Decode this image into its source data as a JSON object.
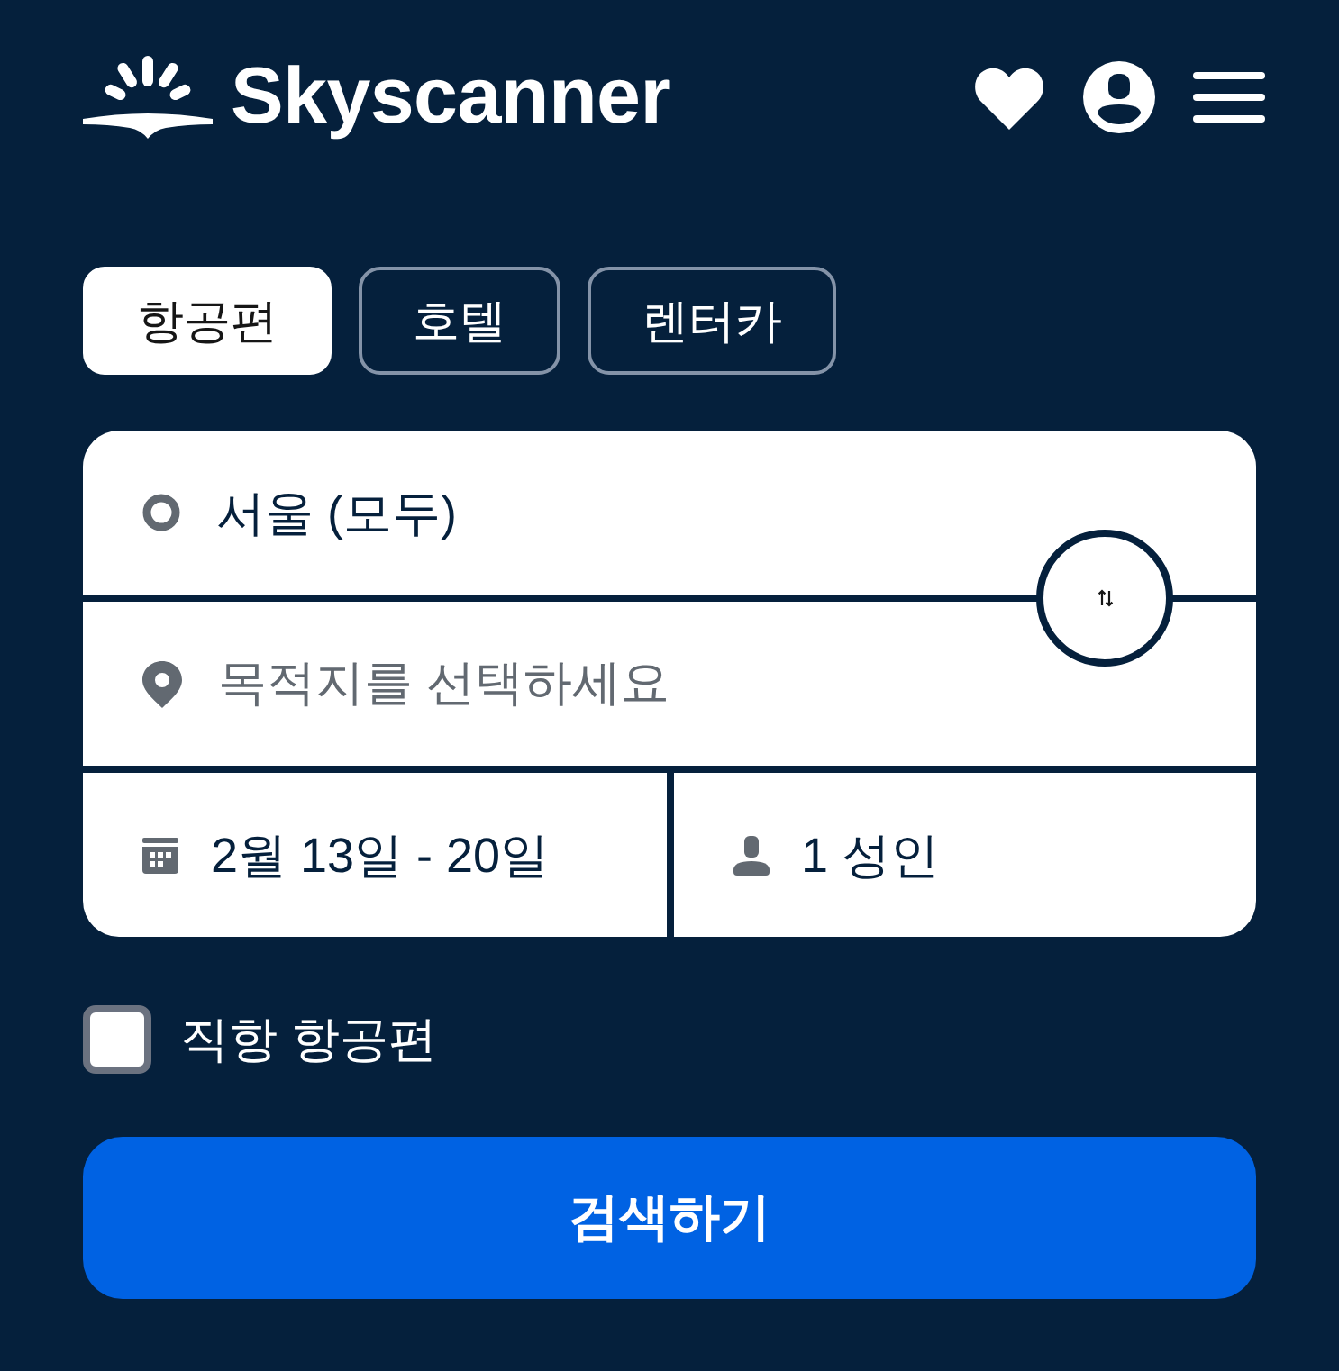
{
  "header": {
    "logo": {
      "text": "Skyscanner"
    }
  },
  "tabs": [
    {
      "label": "항공편",
      "selected": true
    },
    {
      "label": "호텔",
      "selected": false
    },
    {
      "label": "렌터카",
      "selected": false
    }
  ],
  "search_form": {
    "origin": {
      "value": "서울 (모두)"
    },
    "destination": {
      "placeholder": "목적지를 선택하세요"
    },
    "dates": {
      "value": "2월 13일 - 20일"
    },
    "travellers": {
      "value": "1 성인"
    }
  },
  "direct_flights": {
    "label": "직항 항공편",
    "checked": false
  },
  "search_button": {
    "label": "검색하기"
  }
}
